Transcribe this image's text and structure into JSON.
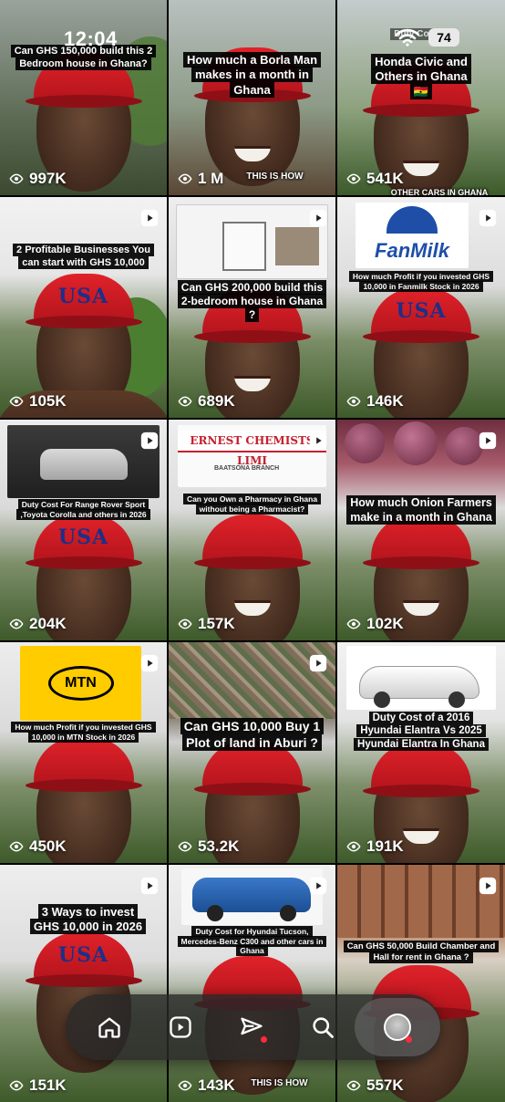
{
  "status_bar": {
    "time": "12:04",
    "battery": "74"
  },
  "tiles": [
    {
      "views": "997K",
      "caption": "Can GHS 150,000 build this 2 Bedroom house in Ghana?",
      "reel": false
    },
    {
      "views": "1 M",
      "caption": "How much a Borla Man makes in a month in Ghana",
      "subtitle": "THIS IS HOW",
      "reel": false
    },
    {
      "views": "541K",
      "caption": "Honda Civic and Others in Ghana🇬🇭",
      "caption_top": "Duty Cost of",
      "subtitle": "OTHER CARS IN GHANA",
      "reel": false
    },
    {
      "views": "105K",
      "caption": "2 Profitable Businesses You can start with GHS 10,000",
      "reel": true
    },
    {
      "views": "689K",
      "caption": "Can GHS 200,000 build this 2-bedroom house in Ghana ?",
      "reel": true
    },
    {
      "views": "146K",
      "caption": "How much Profit if you invested GHS 10,000 in Fanmilk Stock in 2026",
      "logo": "FanMilk",
      "reel": true
    },
    {
      "views": "204K",
      "caption": "Duty Cost For Range Rover Sport ,Toyota Corolla and others in 2026",
      "reel": true
    },
    {
      "views": "157K",
      "caption": "Can you Own a Pharmacy in Ghana without being a Pharmacist?",
      "sign": "ERNEST CHEMISTS LIMI",
      "sign_sub": "BAATSONA BRANCH",
      "reel": true
    },
    {
      "views": "102K",
      "caption": "How much Onion Farmers make in a month in Ghana",
      "reel": true
    },
    {
      "views": "450K",
      "caption": "How much Profit if you invested GHS 10,000 in MTN Stock in 2026",
      "logo": "MTN",
      "reel": true
    },
    {
      "views": "53.2K",
      "caption": "Can GHS 10,000 Buy 1 Plot of land in Aburi ?",
      "reel": true
    },
    {
      "views": "191K",
      "caption": "Duty Cost of a 2016 Hyundai Elantra Vs 2025 Hyundai Elantra In Ghana",
      "reel": true
    },
    {
      "views": "151K",
      "caption": "3 Ways to invest GHS 10,000 in 2026",
      "reel": true
    },
    {
      "views": "143K",
      "caption": "Duty Cost for Hyundai Tucson, Mercedes-Benz C300 and other cars in Ghana",
      "subtitle": "THIS IS HOW",
      "reel": true
    },
    {
      "views": "557K",
      "caption": "Can GHS 50,000 Build Chamber and Hall for rent in Ghana ?",
      "reel": true
    }
  ],
  "nav": {
    "items": [
      "home-icon",
      "reels-icon",
      "send-icon",
      "search-icon",
      "profile-avatar"
    ]
  },
  "colors": {
    "nav_bg": "#282828",
    "notification_dot": "#ff2a3d",
    "cap_red": "#d81e26"
  }
}
